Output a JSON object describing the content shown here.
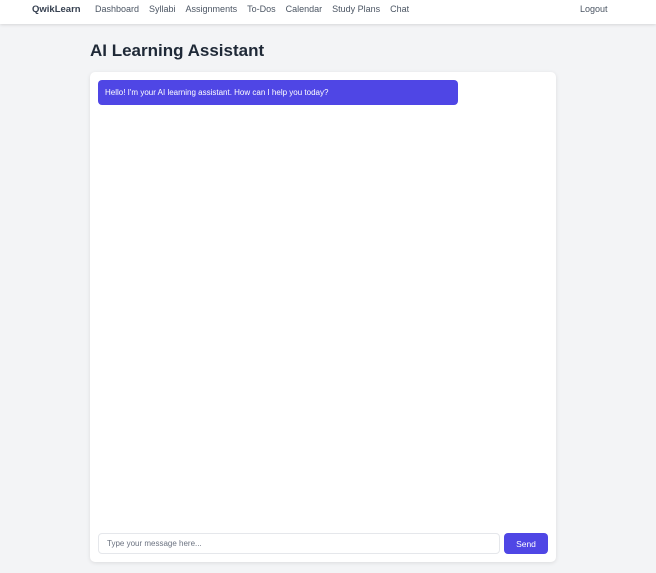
{
  "navbar": {
    "brand": "QwikLearn",
    "links": [
      {
        "label": "Dashboard"
      },
      {
        "label": "Syllabi"
      },
      {
        "label": "Assignments"
      },
      {
        "label": "To-Dos"
      },
      {
        "label": "Calendar"
      },
      {
        "label": "Study Plans"
      },
      {
        "label": "Chat"
      }
    ],
    "logout_label": "Logout"
  },
  "page": {
    "title": "AI Learning Assistant"
  },
  "chat": {
    "messages": [
      {
        "sender": "assistant",
        "text": "Hello! I'm your AI learning assistant. How can I help you today?"
      }
    ],
    "input": {
      "value": "",
      "placeholder": "Type your message here..."
    },
    "send_label": "Send"
  },
  "colors": {
    "accent": "#4f46e5",
    "background": "#f3f4f6",
    "card": "#ffffff"
  }
}
